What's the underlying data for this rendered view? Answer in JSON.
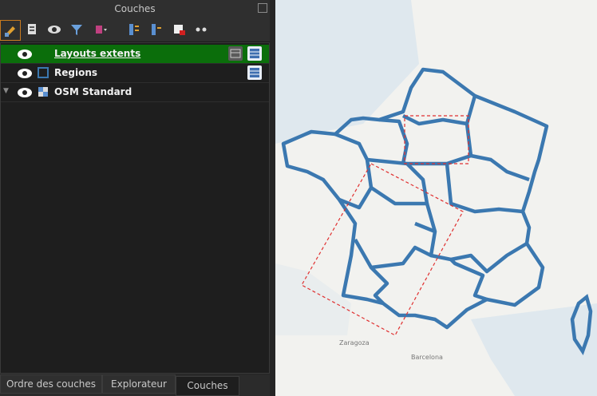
{
  "panel": {
    "title": "Couches",
    "toolbar_icons": [
      "style-manager-icon",
      "add-group-icon",
      "visibility-icon",
      "filter-icon",
      "filter-legend-icon",
      "expand-all-icon",
      "collapse-all-icon",
      "remove-layer-icon",
      "more-icon"
    ]
  },
  "layers": [
    {
      "label": "Layouts extents",
      "selected": true,
      "visible": true,
      "icon": "vector-polygon-icon"
    },
    {
      "label": "Regions",
      "selected": false,
      "visible": true,
      "icon": "polygon-symbol-icon"
    },
    {
      "label": "OSM Standard",
      "selected": false,
      "visible": true,
      "icon": "raster-tile-icon"
    }
  ],
  "tabs": [
    {
      "label": "Ordre des couches",
      "active": false
    },
    {
      "label": "Explorateur",
      "active": false
    },
    {
      "label": "Couches",
      "active": true
    }
  ],
  "map": {
    "region_stroke_color": "#3b78b0",
    "extent_stroke_color": "#e03030",
    "basemap_labels": [
      "Zaragoza",
      "Barcelona"
    ]
  }
}
